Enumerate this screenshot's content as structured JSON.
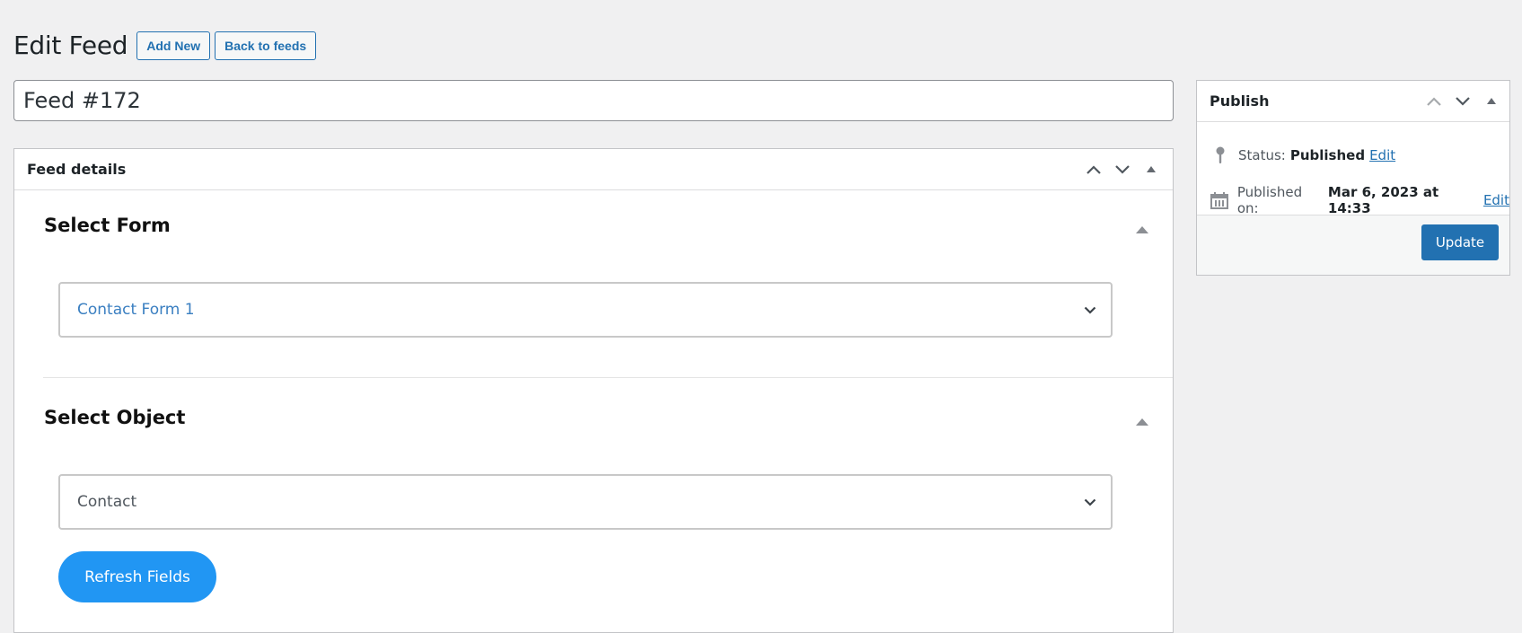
{
  "header": {
    "title": "Edit Feed",
    "add_new_label": "Add New",
    "back_label": "Back to feeds"
  },
  "title_input": {
    "value": "Feed #172"
  },
  "feed_details": {
    "title": "Feed details",
    "sections": [
      {
        "title": "Select Form",
        "select_value": "Contact Form 1",
        "value_color": "#3a7fc1"
      },
      {
        "title": "Select Object",
        "select_value": "Contact",
        "value_color": "#50575e"
      }
    ],
    "refresh_label": "Refresh Fields"
  },
  "publish": {
    "title": "Publish",
    "status_label": "Status:",
    "status_value": "Published",
    "status_edit": "Edit",
    "published_label": "Published on:",
    "published_value": "Mar 6, 2023 at 14:33",
    "published_edit": "Edit",
    "update_label": "Update"
  },
  "colors": {
    "primary": "#2271b1",
    "refresh_button": "#2196f3",
    "background": "#f0f0f1"
  },
  "icons": {
    "move_up": "chevron-up-icon",
    "move_down": "chevron-down-icon",
    "toggle": "triangle-up-icon",
    "status": "pin-icon",
    "date": "calendar-icon",
    "select_arrow": "chevron-down-icon"
  }
}
